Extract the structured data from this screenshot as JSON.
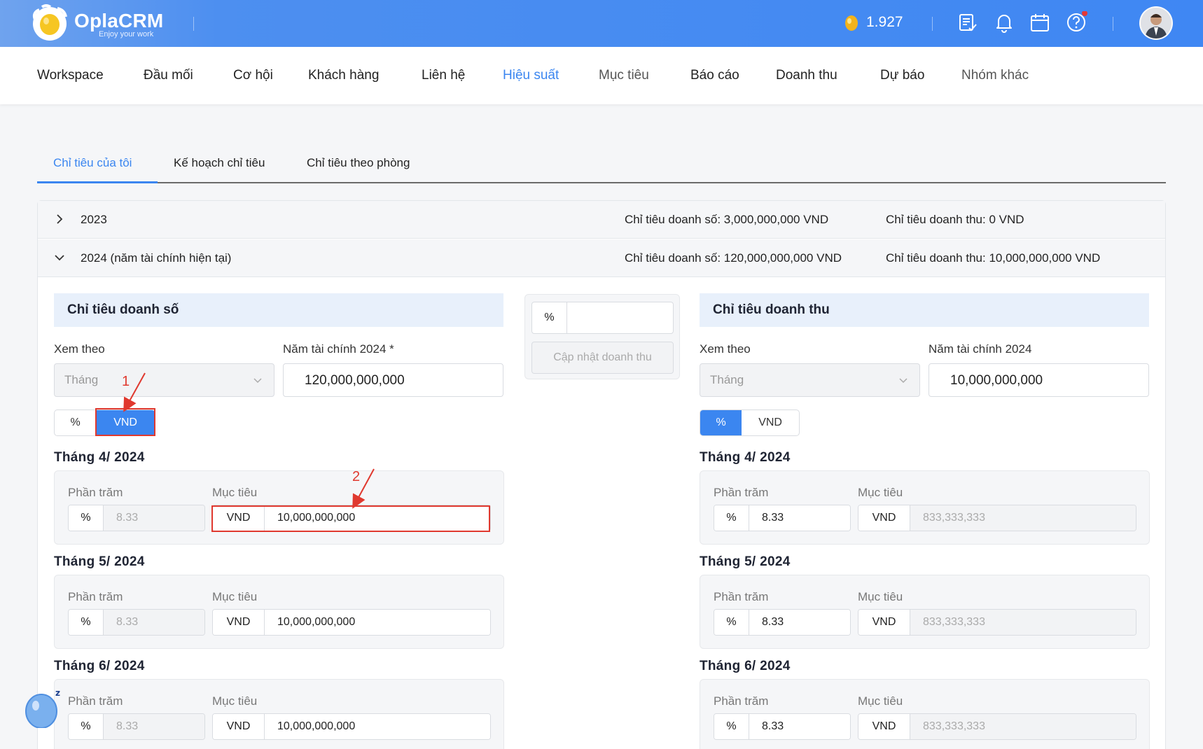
{
  "app": {
    "logo_text": "OplaCRM",
    "tagline": "Enjoy your work",
    "coin_balance": "1.927"
  },
  "colors": {
    "primary": "#3b86f0",
    "annotation": "#e0392f",
    "header": "#3f87f3"
  },
  "header_icons": [
    "coin-icon",
    "document-icon",
    "bell-icon",
    "calendar-icon",
    "help-icon"
  ],
  "nav": {
    "items": [
      "Workspace",
      "Đầu mối",
      "Cơ hội",
      "Khách hàng",
      "Liên hệ",
      "Hiệu suất",
      "Mục tiêu",
      "Báo cáo",
      "Doanh thu",
      "Dự báo",
      "Nhóm khác"
    ],
    "active": "Hiệu suất"
  },
  "tabs": [
    "Chỉ tiêu của tôi",
    "Kế hoạch chỉ tiêu",
    "Chỉ tiêu theo phòng"
  ],
  "years": [
    {
      "label": "2023",
      "sales_target": "Chỉ tiêu doanh số: 3,000,000,000 VND",
      "revenue_target": "Chỉ tiêu doanh thu: 0 VND"
    },
    {
      "label": "2024 (năm tài chính hiện tại)",
      "sales_target": "Chỉ tiêu doanh số: 120,000,000,000 VND",
      "revenue_target": "Chỉ tiêu doanh thu: 10,000,000,000 VND"
    }
  ],
  "sales": {
    "title": "Chỉ tiêu doanh số",
    "view_by_label": "Xem theo",
    "view_by_value": "Tháng",
    "fiscal_label": "Năm tài chính 2024 *",
    "fiscal_value": "120,000,000,000",
    "toggle": {
      "pct": "%",
      "vnd": "VND",
      "selected": "VND"
    }
  },
  "middle": {
    "pct_addon": "%",
    "pct_value": "",
    "update_button": "Cập nhật doanh thu"
  },
  "revenue": {
    "title": "Chỉ tiêu doanh thu",
    "view_by_label": "Xem theo",
    "view_by_value": "Tháng",
    "fiscal_label": "Năm tài chính 2024",
    "fiscal_value": "10,000,000,000",
    "toggle": {
      "pct": "%",
      "vnd": "VND",
      "selected": "%"
    }
  },
  "labels": {
    "percent": "Phần trăm",
    "target": "Mục tiêu",
    "pct_addon": "%",
    "vnd_addon": "VND"
  },
  "months": [
    {
      "title": "Tháng 4/ 2024",
      "sales_pct": "8.33",
      "sales_vnd": "10,000,000,000",
      "rev_pct": "8.33",
      "rev_vnd": "833,333,333"
    },
    {
      "title": "Tháng 5/ 2024",
      "sales_pct": "8.33",
      "sales_vnd": "10,000,000,000",
      "rev_pct": "8.33",
      "rev_vnd": "833,333,333"
    },
    {
      "title": "Tháng 6/ 2024",
      "sales_pct": "8.33",
      "sales_vnd": "10,000,000,000",
      "rev_pct": "8.33",
      "rev_vnd": "833,333,333"
    }
  ],
  "annotations": [
    "1",
    "2"
  ]
}
